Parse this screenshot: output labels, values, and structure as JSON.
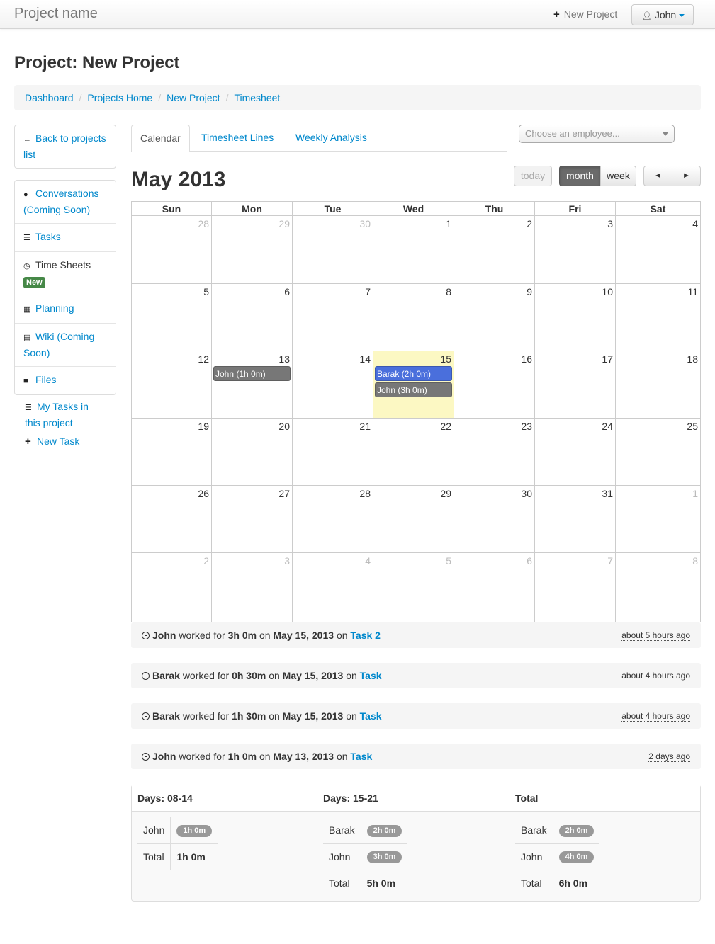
{
  "navbar": {
    "brand": "Project name",
    "new_project": "New Project",
    "user": "John"
  },
  "page": {
    "title": "Project: New Project"
  },
  "breadcrumb": [
    "Dashboard",
    "Projects Home",
    "New Project",
    "Timesheet"
  ],
  "sidebar": {
    "back": "Back to projects list",
    "items": [
      {
        "label": "Conversations (Coming Soon)",
        "icon": "comment-icon"
      },
      {
        "label": "Tasks",
        "icon": "list-icon"
      },
      {
        "label": "Time Sheets",
        "icon": "clock-icon",
        "badge": "New"
      },
      {
        "label": "Planning",
        "icon": "calendar-icon"
      },
      {
        "label": "Wiki (Coming Soon)",
        "icon": "file-icon"
      },
      {
        "label": "Files",
        "icon": "folder-icon"
      }
    ],
    "links": {
      "my_tasks": "My Tasks in this project",
      "new_task": "New Task"
    }
  },
  "tabs": [
    "Calendar",
    "Timesheet Lines",
    "Weekly Analysis"
  ],
  "employee_select": {
    "placeholder": "Choose an employee..."
  },
  "calendar": {
    "title": "May 2013",
    "buttons": {
      "today": "today",
      "month": "month",
      "week": "week",
      "prev": "◄",
      "next": "►"
    },
    "weekdays": [
      "Sun",
      "Mon",
      "Tue",
      "Wed",
      "Thu",
      "Fri",
      "Sat"
    ],
    "weeks": [
      [
        "28",
        "29",
        "30",
        "1",
        "2",
        "3",
        "4"
      ],
      [
        "5",
        "6",
        "7",
        "8",
        "9",
        "10",
        "11"
      ],
      [
        "12",
        "13",
        "14",
        "15",
        "16",
        "17",
        "18"
      ],
      [
        "19",
        "20",
        "21",
        "22",
        "23",
        "24",
        "25"
      ],
      [
        "26",
        "27",
        "28",
        "29",
        "30",
        "31",
        "1"
      ],
      [
        "2",
        "3",
        "4",
        "5",
        "6",
        "7",
        "8"
      ]
    ],
    "events": [
      {
        "day": "13",
        "label": "John (1h 0m)",
        "color": "#777777"
      },
      {
        "day": "15",
        "label": "Barak (2h 0m)",
        "color": "#4a6fdc"
      },
      {
        "day": "15",
        "label": "John (3h 0m)",
        "color": "#777777"
      }
    ]
  },
  "activity": [
    {
      "user": "John",
      "worked_for": "worked for",
      "duration": "3h 0m",
      "on1": "on",
      "date": "May 15, 2013",
      "on2": "on",
      "task": "Task 2",
      "ago": "about 5 hours ago"
    },
    {
      "user": "Barak",
      "worked_for": "worked for",
      "duration": "0h 30m",
      "on1": "on",
      "date": "May 15, 2013",
      "on2": "on",
      "task": "Task",
      "ago": "about 4 hours ago"
    },
    {
      "user": "Barak",
      "worked_for": "worked for",
      "duration": "1h 30m",
      "on1": "on",
      "date": "May 15, 2013",
      "on2": "on",
      "task": "Task",
      "ago": "about 4 hours ago"
    },
    {
      "user": "John",
      "worked_for": "worked for",
      "duration": "1h 0m",
      "on1": "on",
      "date": "May 13, 2013",
      "on2": "on",
      "task": "Task",
      "ago": "2 days ago"
    }
  ],
  "summary": [
    {
      "header": "Days: 08-14",
      "rows": [
        {
          "name": "John",
          "value": "1h 0m"
        }
      ],
      "total_label": "Total",
      "total": "1h 0m"
    },
    {
      "header": "Days: 15-21",
      "rows": [
        {
          "name": "Barak",
          "value": "2h 0m"
        },
        {
          "name": "John",
          "value": "3h 0m"
        }
      ],
      "total_label": "Total",
      "total": "5h 0m"
    },
    {
      "header": "Total",
      "rows": [
        {
          "name": "Barak",
          "value": "2h 0m"
        },
        {
          "name": "John",
          "value": "4h 0m"
        }
      ],
      "total_label": "Total",
      "total": "6h 0m"
    }
  ]
}
